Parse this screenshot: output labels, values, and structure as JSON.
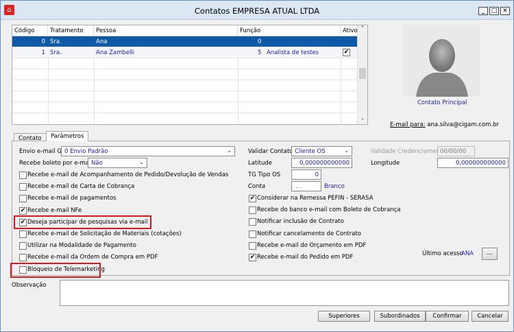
{
  "window": {
    "title": "Contatos EMPRESA ATUAL LTDA",
    "controls": [
      "_",
      "□",
      "✕"
    ]
  },
  "grid": {
    "columns": [
      "Código",
      "Tratamento",
      "Pessoa",
      "Função",
      "Ativo"
    ],
    "rows": [
      {
        "codigo": "0",
        "tratamento": "Sra.",
        "pessoa": "Ana",
        "funcao_code": "0",
        "funcao": "",
        "ativo": false
      },
      {
        "codigo": "1",
        "tratamento": "Sra.",
        "pessoa": "Ana Zambelli",
        "funcao_code": "5",
        "funcao": "Analista de testes",
        "ativo": true
      }
    ]
  },
  "photo": {
    "caption": "Contato Principal",
    "email_label": "E-mail para:",
    "email": "ana.silva@cigam.com.br"
  },
  "tabs": [
    "Contato",
    "Parâmetros"
  ],
  "left": {
    "envio_label": "Envio e-mail GS",
    "envio_value": "0 Envio Padrão",
    "boleto_label": "Recebe boleto por e-mail",
    "boleto_value": "Não",
    "checks": [
      {
        "label": "Recebe e-mail de Acompanhamento de Pedido/Devolução de Vendas",
        "checked": false
      },
      {
        "label": "Recebe e-mail de Carta de Cobrança",
        "checked": false
      },
      {
        "label": "Recebe e-mail de pagamentos",
        "checked": false
      },
      {
        "label": "Recebe e-mail NFe",
        "checked": true
      },
      {
        "label": "Deseja participar de pesquisas via e-mail",
        "checked": true
      },
      {
        "label": "Recebe e-mail de Solicitação de Materiais (cotações)",
        "checked": false
      },
      {
        "label": "Utilizar na Modalidade de Pagamento",
        "checked": false
      },
      {
        "label": "Recebe e-mail da Ordem de Compra em PDF",
        "checked": false
      },
      {
        "label": "Bloqueio de Telemarketing",
        "checked": false
      }
    ]
  },
  "right": {
    "validar_label": "Validar Contato",
    "validar_value": "Cliente  OS",
    "validade_label": "Validade Credenciamento",
    "validade_value": "00/00/00",
    "latitude_label": "Latitude",
    "latitude_value": "0,000000000000",
    "longitude_label": "Longitude",
    "longitude_value": "0,000000000000",
    "tg_label": "TG Tipo OS",
    "tg_value": "0",
    "conta_label": "Conta",
    "conta_value": ". .",
    "conta_desc": "Branco",
    "checks": [
      {
        "label": "Considerar na Remessa PEFIN - SERASA",
        "checked": true
      },
      {
        "label": "Recebe do banco e-mail com Boleto de Cobrança",
        "checked": false
      },
      {
        "label": "Notificar inclusão de Contrato",
        "checked": false
      },
      {
        "label": "Notificar cancelamento de Contrato",
        "checked": false
      },
      {
        "label": "Recebe e-mail do Orçamento em PDF",
        "checked": false
      },
      {
        "label": "Recebe e-mail do Pedido em PDF",
        "checked": true
      }
    ],
    "ultimo_label": "Último acesso",
    "ultimo_value": "ANA",
    "more": "..."
  },
  "observacao_label": "Observação",
  "buttons": {
    "superiores": "Superiores",
    "subordinados": "Subordinados",
    "confirmar": "Confirmar",
    "cancelar": "Cancelar"
  }
}
